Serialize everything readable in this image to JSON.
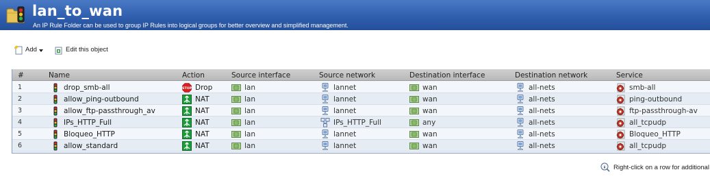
{
  "header": {
    "title": "lan_to_wan",
    "subtitle": "An IP Rule Folder can be used to group IP Rules into logical groups for better overview and simplified management."
  },
  "toolbar": {
    "add_label": "Add",
    "edit_label": "Edit this object"
  },
  "table": {
    "columns": [
      "#",
      "Name",
      "Action",
      "Source interface",
      "Source network",
      "Destination interface",
      "Destination network",
      "Service"
    ],
    "rows": [
      {
        "num": "1",
        "name": "drop_smb-all",
        "action": "Drop",
        "action_icon": "stop-icon",
        "src_if": "lan",
        "src_net": "lannet",
        "src_net_icon": "network-object-icon",
        "dst_if": "wan",
        "dst_net": "all-nets",
        "service": "smb-all"
      },
      {
        "num": "2",
        "name": "allow_ping-outbound",
        "action": "NAT",
        "action_icon": "nat-icon",
        "src_if": "lan",
        "src_net": "lannet",
        "src_net_icon": "network-object-icon",
        "dst_if": "wan",
        "dst_net": "all-nets",
        "service": "ping-outbound"
      },
      {
        "num": "3",
        "name": "allow_ftp-passthrough_av",
        "action": "NAT",
        "action_icon": "nat-icon",
        "src_if": "lan",
        "src_net": "lannet",
        "src_net_icon": "network-object-icon",
        "dst_if": "wan",
        "dst_net": "all-nets",
        "service": "ftp-passthrough-av"
      },
      {
        "num": "4",
        "name": "IPs_HTTP_Full",
        "action": "NAT",
        "action_icon": "nat-icon",
        "src_if": "lan",
        "src_net": "IPs_HTTP_Full",
        "src_net_icon": "network-group-icon",
        "dst_if": "any",
        "dst_net": "all-nets",
        "service": "all_tcpudp"
      },
      {
        "num": "5",
        "name": "Bloqueo_HTTP",
        "action": "NAT",
        "action_icon": "nat-icon",
        "src_if": "lan",
        "src_net": "lannet",
        "src_net_icon": "network-object-icon",
        "dst_if": "wan",
        "dst_net": "all-nets",
        "service": "Bloqueo_HTTP"
      },
      {
        "num": "6",
        "name": "allow_standard",
        "action": "NAT",
        "action_icon": "nat-icon",
        "src_if": "lan",
        "src_net": "lannet",
        "src_net_icon": "network-object-icon",
        "dst_if": "wan",
        "dst_net": "all-nets",
        "service": "all_tcpudp"
      }
    ]
  },
  "status": {
    "hint": "Right-click on a row for additional"
  },
  "colors": {
    "header_blue": "#2f5fae",
    "nat_green": "#1f9a3a",
    "drop_red": "#d81e1e",
    "service_red": "#c0392b"
  },
  "icons": [
    "folder-traffic-light-icon",
    "add-icon",
    "edit-icon",
    "traffic-light-icon",
    "stop-icon",
    "nat-icon",
    "interface-icon",
    "network-object-icon",
    "network-group-icon",
    "service-icon",
    "info-icon"
  ]
}
